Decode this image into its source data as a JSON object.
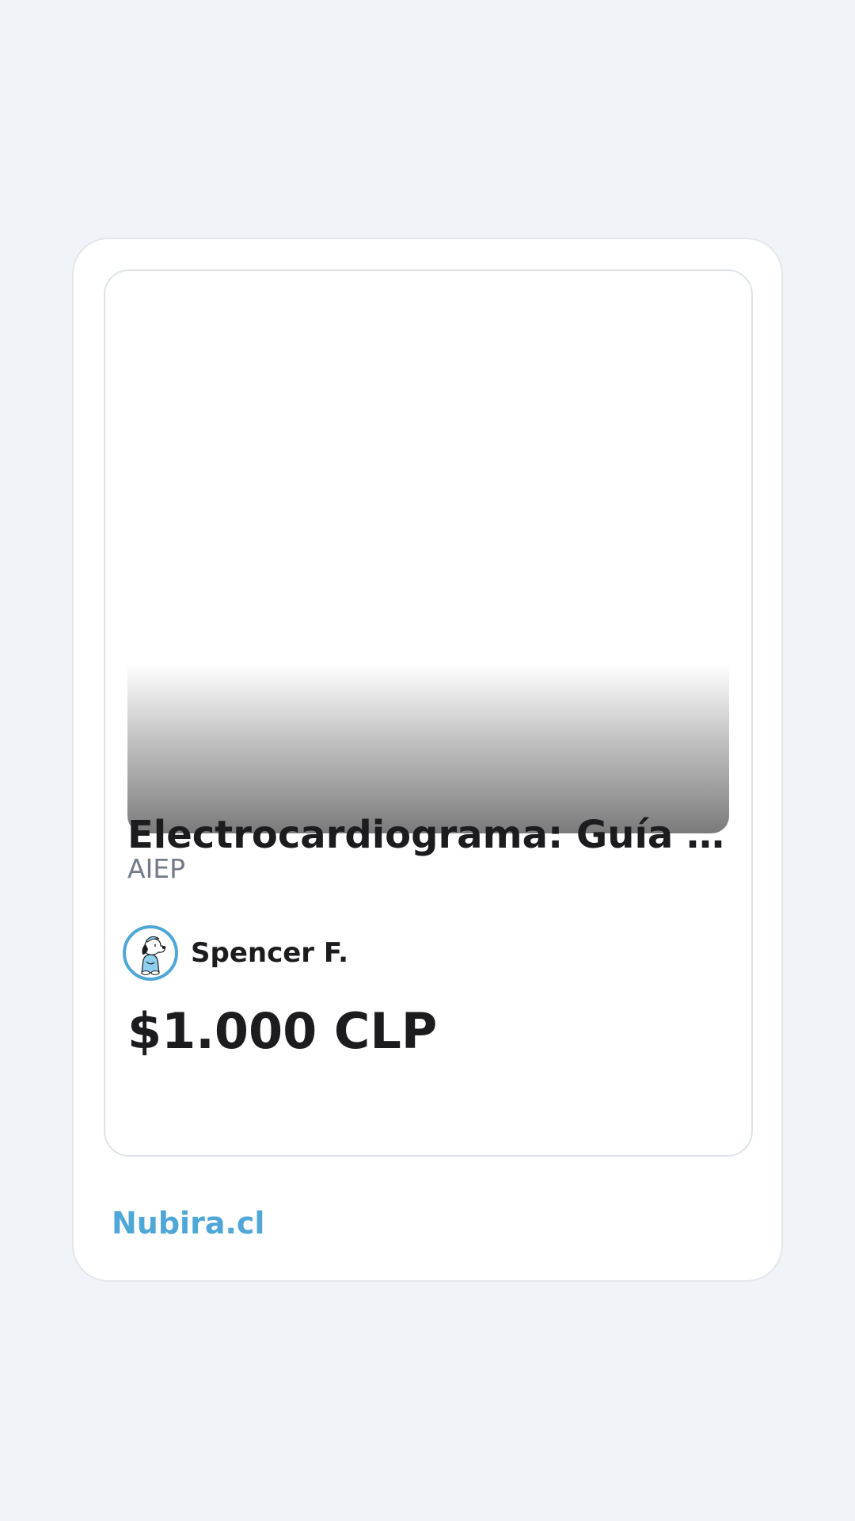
{
  "product": {
    "title": "Electrocardiograma: Guía De...",
    "institution": "AIEP",
    "price": "$1.000 CLP"
  },
  "seller": {
    "name": "Spencer F.",
    "avatar_icon": "snoopy-avatar-icon"
  },
  "footer": {
    "brand": "Nubira.cl"
  },
  "colors": {
    "background": "#f0f4f8",
    "accent": "#4fa7d8",
    "text": "#1c1c1e",
    "muted": "#737a88"
  }
}
